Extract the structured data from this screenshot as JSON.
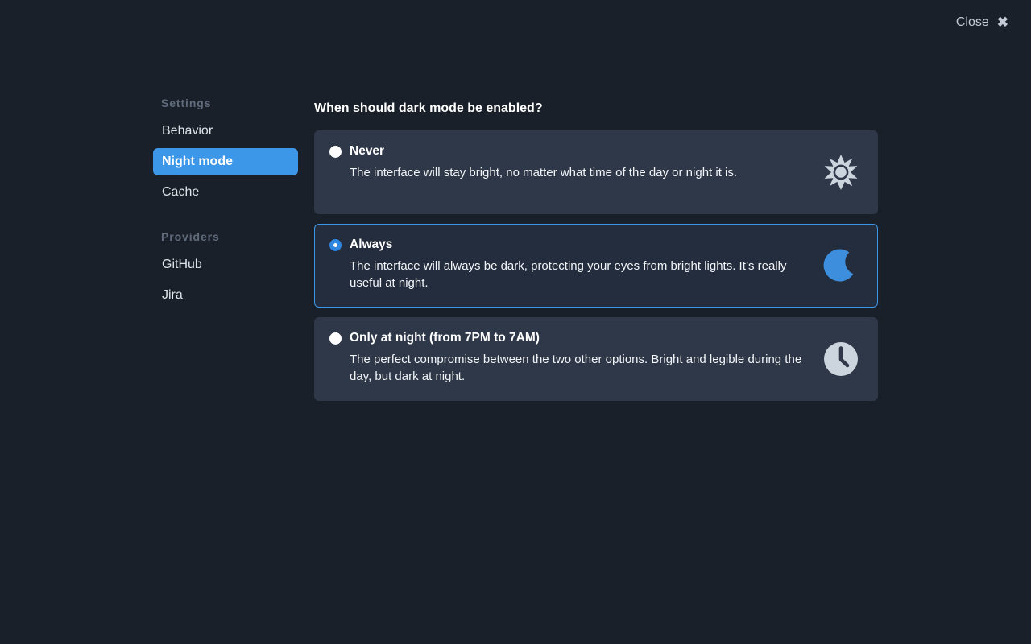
{
  "header": {
    "close_label": "Close",
    "close_icon": "close-x-icon"
  },
  "sidebar": {
    "sections": [
      {
        "label": "Settings",
        "items": [
          {
            "label": "Behavior",
            "active": false
          },
          {
            "label": "Night mode",
            "active": true
          },
          {
            "label": "Cache",
            "active": false
          }
        ]
      },
      {
        "label": "Providers",
        "items": [
          {
            "label": "GitHub",
            "active": false
          },
          {
            "label": "Jira",
            "active": false
          }
        ]
      }
    ]
  },
  "main": {
    "heading": "When should dark mode be enabled?",
    "options": [
      {
        "title": "Never",
        "description": "The interface will stay bright, no matter what time of the day or night it is.",
        "selected": false,
        "icon": "sun-icon"
      },
      {
        "title": "Always",
        "description": "The interface will always be dark, protecting your eyes from bright lights. It’s really useful at night.",
        "selected": true,
        "icon": "moon-icon"
      },
      {
        "title": "Only at night (from 7PM to 7AM)",
        "description": "The perfect compromise between the two other options. Bright and legible during the day, but dark at night.",
        "selected": false,
        "icon": "clock-icon"
      }
    ]
  },
  "colors": {
    "page_background": "#1a2029",
    "card_background": "#2f3848",
    "card_selected_background": "#242d3d",
    "accent_blue": "#3d97e8",
    "moon_blue": "#3d8fdd",
    "icon_light": "#ccd4de",
    "section_label": "#5f6b7c",
    "text_primary": "#ffffff"
  }
}
